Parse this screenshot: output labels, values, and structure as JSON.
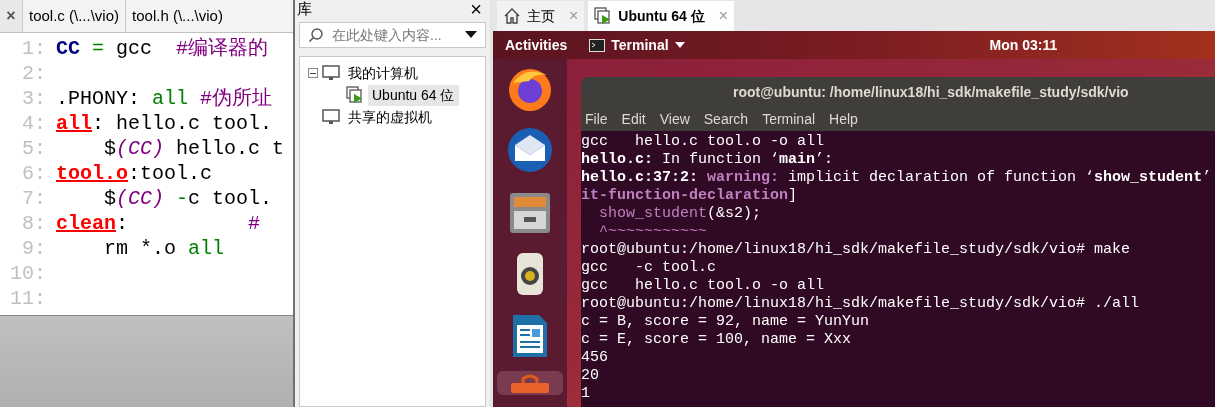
{
  "editor": {
    "close": "×",
    "tabs": [
      {
        "label": "tool.c (\\...\\vio)",
        "selected": false
      },
      {
        "label": "tool.h (\\...\\vio)",
        "selected": false
      }
    ],
    "lines": [
      {
        "number": "1:",
        "tokens": [
          {
            "kind": "variable",
            "text": "CC"
          },
          {
            "kind": "operator",
            "text": " ="
          },
          {
            "kind": "plain",
            "text": " gcc  "
          },
          {
            "kind": "comment",
            "text": "#编译器的"
          }
        ]
      },
      {
        "number": "2:"
      },
      {
        "number": "3:",
        "tokens": [
          {
            "kind": "plain",
            "text": ".PHONY: "
          },
          {
            "kind": "builtin",
            "text": "all"
          },
          {
            "kind": "comment",
            "text": " #伪所址"
          }
        ]
      },
      {
        "number": "4:",
        "tokens": [
          {
            "kind": "target",
            "text": "all"
          },
          {
            "kind": "plain",
            "text": ": hello.c tool."
          }
        ]
      },
      {
        "number": "5:",
        "tokens": [
          {
            "kind": "plain",
            "text": "    $"
          },
          {
            "kind": "macro",
            "text": "(CC)"
          },
          {
            "kind": "plain",
            "text": " hello.c t"
          }
        ]
      },
      {
        "number": "6:",
        "tokens": [
          {
            "kind": "target",
            "text": "tool.o"
          },
          {
            "kind": "plain",
            "text": ":tool.c"
          }
        ]
      },
      {
        "number": "7:",
        "tokens": [
          {
            "kind": "plain",
            "text": "    $"
          },
          {
            "kind": "macro",
            "text": "(CC)"
          },
          {
            "kind": "operator",
            "text": " -"
          },
          {
            "kind": "plain",
            "text": "c tool."
          }
        ]
      },
      {
        "number": "8:",
        "tokens": [
          {
            "kind": "target",
            "text": "clean"
          },
          {
            "kind": "plain",
            "text": ":          "
          },
          {
            "kind": "comment",
            "text": "#"
          }
        ]
      },
      {
        "number": "9:",
        "tokens": [
          {
            "kind": "plain",
            "text": "    rm *.o "
          },
          {
            "kind": "builtin",
            "text": "all"
          }
        ]
      },
      {
        "number": "10:"
      },
      {
        "number": "11:"
      }
    ]
  },
  "library": {
    "title": "库",
    "close": "×",
    "search": {
      "placeholder": "在此处键入内容..."
    },
    "tree": [
      {
        "label": "我的计算机",
        "expanded": true,
        "selected": false,
        "children": [
          {
            "label": "Ubuntu 64 位",
            "selected": true
          }
        ]
      },
      {
        "label": "共享的虚拟机",
        "selected": false
      }
    ]
  },
  "vm_tabs": [
    {
      "label": "主页",
      "selected": false,
      "close": "×"
    },
    {
      "label": "Ubuntu 64 位",
      "selected": true,
      "close": "×"
    }
  ],
  "top_bar": {
    "activities": "Activities",
    "app": "Terminal",
    "clock": "Mon 03:11"
  },
  "terminal": {
    "title": "root@ubuntu: /home/linux18/hi_sdk/makefile_study/sdk/vio",
    "menu": [
      "File",
      "Edit",
      "View",
      "Search",
      "Terminal",
      "Help"
    ],
    "lines": [
      [
        {
          "kind": "plain",
          "text": "gcc   hello.c tool.o -o all"
        }
      ],
      [
        {
          "kind": "bold",
          "text": "hello.c:"
        },
        {
          "kind": "plain",
          "text": " In function ‘"
        },
        {
          "kind": "bold",
          "text": "main"
        },
        {
          "kind": "plain",
          "text": "’:"
        }
      ],
      [
        {
          "kind": "bold",
          "text": "hello.c:37:2:"
        },
        {
          "kind": "warning",
          "text": " warning:"
        },
        {
          "kind": "plain",
          "text": " implicit declaration of function ‘"
        },
        {
          "kind": "bold",
          "text": "show_student"
        },
        {
          "kind": "plain",
          "text": "’"
        }
      ],
      [
        {
          "kind": "warning",
          "text": "it-function-declaration"
        },
        {
          "kind": "plain",
          "text": "]"
        }
      ],
      [
        {
          "kind": "warning_dim",
          "text": "  show_student"
        },
        {
          "kind": "plain",
          "text": "(&s2);"
        }
      ],
      [
        {
          "kind": "warning_dim",
          "text": "  ^~~~~~~~~~~~"
        }
      ],
      [
        {
          "kind": "plain",
          "text": "root@ubuntu:/home/linux18/hi_sdk/makefile_study/sdk/vio# make"
        }
      ],
      [
        {
          "kind": "plain",
          "text": "gcc   -c tool.c"
        }
      ],
      [
        {
          "kind": "plain",
          "text": "gcc   hello.c tool.o -o all"
        }
      ],
      [
        {
          "kind": "plain",
          "text": "root@ubuntu:/home/linux18/hi_sdk/makefile_study/sdk/vio# ./all"
        }
      ],
      [
        {
          "kind": "plain",
          "text": "c = B, score = 92, name = YunYun"
        }
      ],
      [
        {
          "kind": "plain",
          "text": "c = E, score = 100, name = Xxx"
        }
      ],
      [
        {
          "kind": "plain",
          "text": "456"
        }
      ],
      [
        {
          "kind": "plain",
          "text": "20"
        }
      ],
      [
        {
          "kind": "plain",
          "text": "1"
        }
      ]
    ]
  },
  "dock": [
    {
      "selected": false
    },
    {
      "selected": false
    },
    {
      "selected": false
    },
    {
      "selected": false
    },
    {
      "selected": false
    },
    {
      "selected": true
    }
  ]
}
